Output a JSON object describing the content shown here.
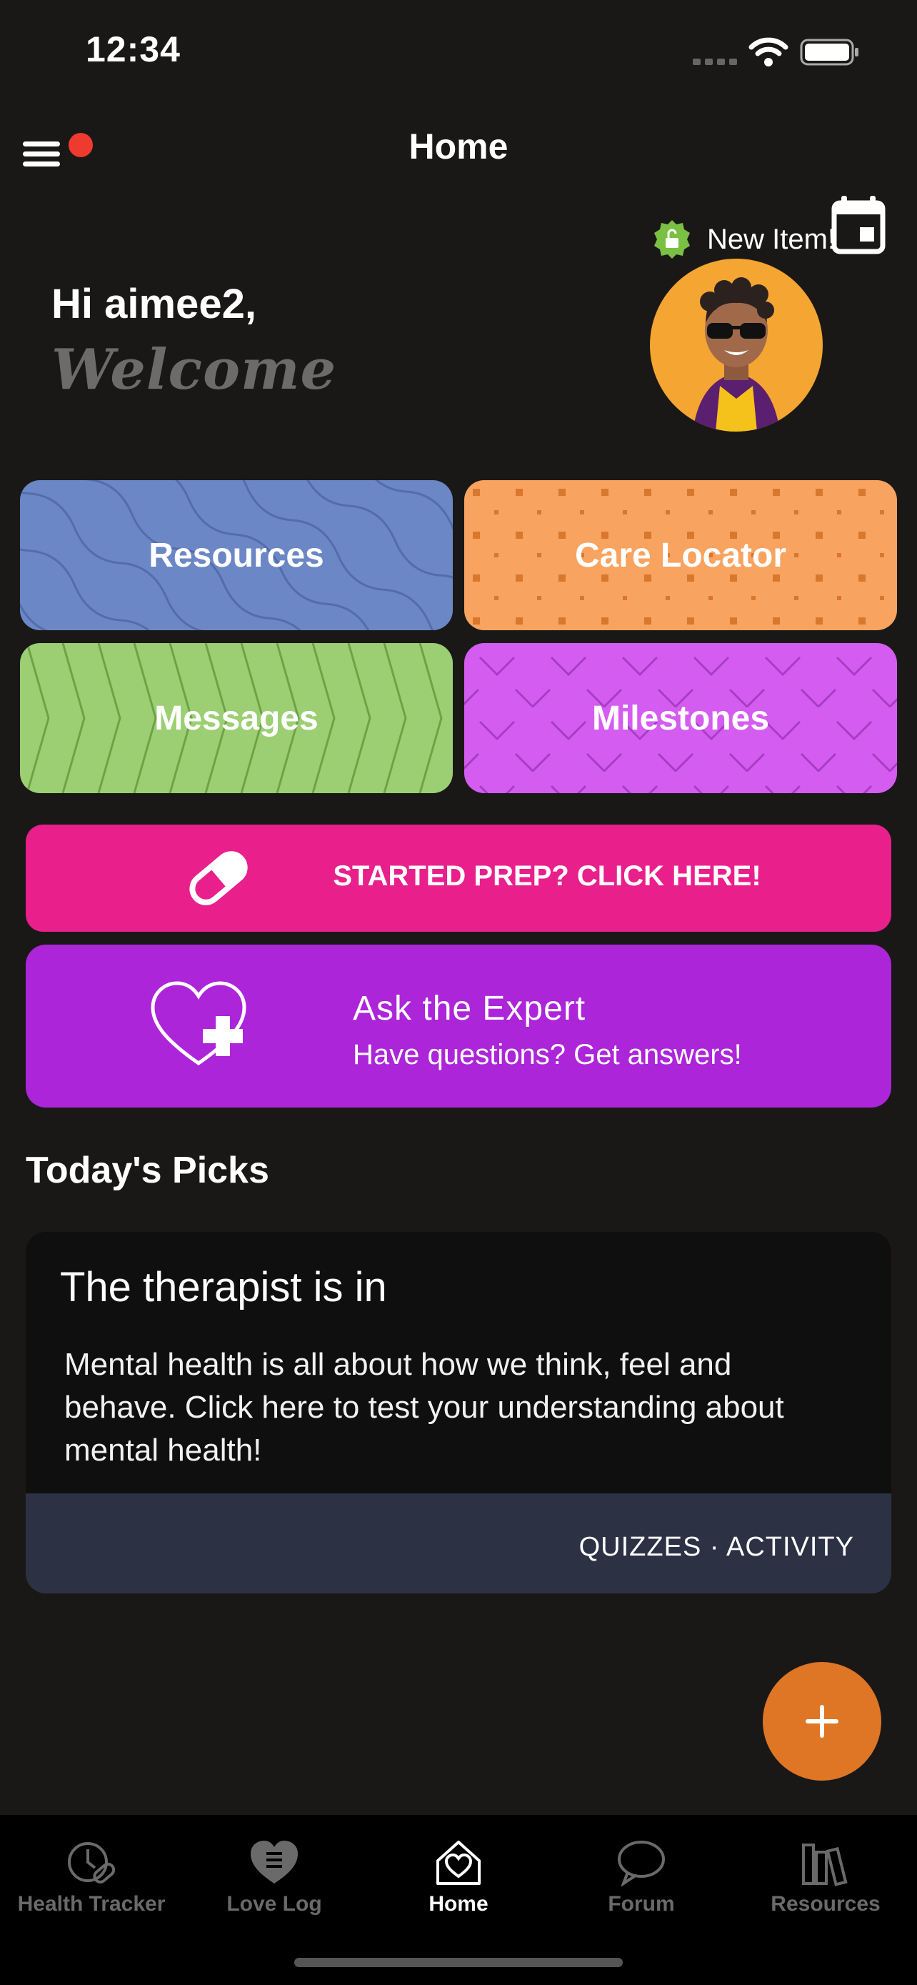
{
  "status_bar": {
    "time": "12:34"
  },
  "header": {
    "title": "Home"
  },
  "new_item": {
    "label": "New Item!"
  },
  "greeting": {
    "hello": "Hi aimee2,",
    "welcome": "Welcome"
  },
  "tiles": [
    {
      "label": "Resources",
      "color": "#6b87c6"
    },
    {
      "label": "Care Locator",
      "color": "#f8a35f"
    },
    {
      "label": "Messages",
      "color": "#9ccf73"
    },
    {
      "label": "Milestones",
      "color": "#d55cf0"
    }
  ],
  "prep_banner": {
    "label": "STARTED PREP? CLICK HERE!",
    "color": "#e91f8c"
  },
  "expert_banner": {
    "title": "Ask the Expert",
    "subtitle": "Have questions? Get answers!",
    "color": "#ac25d9"
  },
  "todays_picks": {
    "heading": "Today's Picks",
    "card": {
      "title": "The therapist is in",
      "description": "Mental health is all about how we think, feel and behave. Click here to test your understanding about mental health!",
      "tags": "QUIZZES · ACTIVITY"
    }
  },
  "fab": {
    "icon": "plus-icon",
    "color": "#de7626"
  },
  "tab_bar": {
    "items": [
      {
        "label": "Health Tracker",
        "icon": "health-tracker-icon",
        "active": false
      },
      {
        "label": "Love Log",
        "icon": "heart-log-icon",
        "active": false
      },
      {
        "label": "Home",
        "icon": "home-heart-icon",
        "active": true
      },
      {
        "label": "Forum",
        "icon": "chat-bubble-icon",
        "active": false
      },
      {
        "label": "Resources",
        "icon": "books-icon",
        "active": false
      }
    ]
  }
}
